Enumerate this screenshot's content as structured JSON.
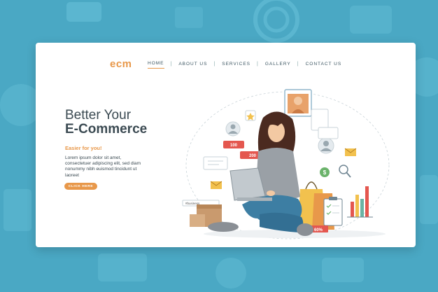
{
  "brand": {
    "logo": "ecm"
  },
  "nav": {
    "items": [
      {
        "label": "HOME",
        "active": true
      },
      {
        "label": "ABOUT US",
        "active": false
      },
      {
        "label": "SERVICES",
        "active": false
      },
      {
        "label": "GALLERY",
        "active": false
      },
      {
        "label": "CONTACT US",
        "active": false
      }
    ],
    "separator": "|"
  },
  "hero": {
    "title_line1": "Better Your",
    "title_line2": "E-Commerce",
    "subtitle": "Easier for you!",
    "body": "Lorem ipsum dolor sit amet, consectetuer adipiscing elit, sed diam nonummy nibh euismod tincidunt ut laoreet",
    "cta_label": "CLICK HERE"
  },
  "illustration": {
    "like_count": "100",
    "heart_count": "200",
    "discount": "60%",
    "hashtag": "#business"
  },
  "colors": {
    "accent": "#e8984a",
    "background": "#4aa8c4",
    "text": "#3b4a52",
    "badge_red": "#e4574f"
  }
}
